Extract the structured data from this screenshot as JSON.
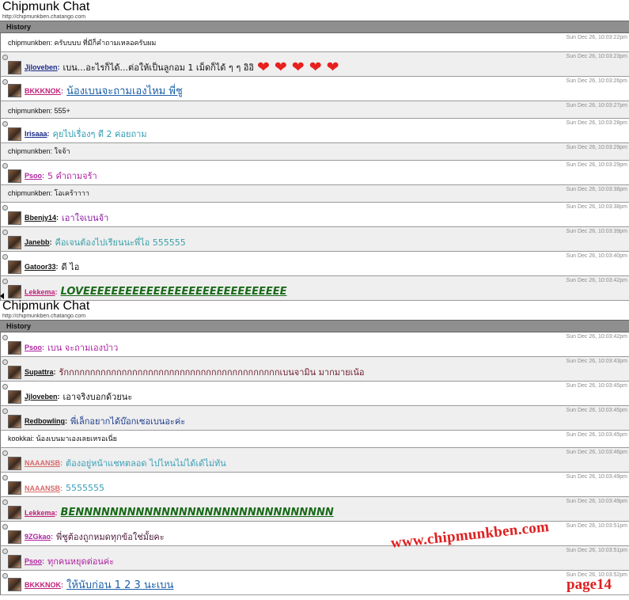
{
  "panels": [
    {
      "title": "Chipmunk Chat",
      "url": "http://chipmunkben.chatango.com",
      "history_label": "History",
      "messages": [
        {
          "type": "sys",
          "text": "chipmunkben: ครับบบบ ที่มีก็คำถามเหลอครับผม",
          "ts": "Sun Dec 26, 10:03:22pm"
        },
        {
          "type": "user",
          "name": "Jjloveben",
          "text": "เบน...อะไรก็ได้...ต่อให้เป็นลูกอม 1 เม็ดก็ได้ ๆ ๆ อิอิ",
          "ts": "Sun Dec 26, 10:03:23pm",
          "name_color": "#1a2a8a",
          "text_color": "#111111",
          "hearts": 5
        },
        {
          "type": "user",
          "name": "BKKKNOK",
          "text": "น้องเบนจะถามเองไหม พี่ชู",
          "ts": "Sun Dec 26, 10:03:26pm",
          "name_color": "#c0207a",
          "text_color": "#1a5fa8",
          "style": "ul"
        },
        {
          "type": "sys",
          "text": "chipmunkben: 555+",
          "ts": "Sun Dec 26, 10:03:27pm"
        },
        {
          "type": "user",
          "name": "lrisaaa",
          "text": "คุยไปเรื่องๆ ดี 2 ค่อยถาม",
          "ts": "Sun Dec 26, 10:03:28pm",
          "name_color": "#1a2a8a",
          "text_color": "#2e9bb2"
        },
        {
          "type": "sys",
          "text": "chipmunkben: ใจจ้า",
          "ts": "Sun Dec 26, 10:03:29pm"
        },
        {
          "type": "user",
          "name": "Psoo",
          "text": "5 คำถามจร้า",
          "ts": "Sun Dec 26, 10:03:29pm",
          "name_color": "#b020a0",
          "text_color": "#b020a0"
        },
        {
          "type": "sys",
          "text": "chipmunkben: โอเคร้าาาา",
          "ts": "Sun Dec 26, 10:03:38pm"
        },
        {
          "type": "user",
          "name": "Bbenjy14",
          "text": "เอาใจเบนจ้า",
          "ts": "Sun Dec 26, 10:03:38pm",
          "name_color": "#111111",
          "text_color": "#8a1aa0"
        },
        {
          "type": "user",
          "name": "Janebb",
          "text": "คือเจนต้องไปเรียนนะพี่ไอ 555555",
          "ts": "Sun Dec 26, 10:03:39pm",
          "name_color": "#111111",
          "text_color": "#3aa0a8"
        },
        {
          "type": "user",
          "name": "Gatoor33",
          "text": "ดี ไอ",
          "ts": "Sun Dec 26, 10:03:40pm",
          "name_color": "#111111",
          "text_color": "#111111"
        },
        {
          "type": "user",
          "name": "Lekkema",
          "text": "LOVEEEEEEEEEEEEEEEEEEEEEEEEEEEEE",
          "ts": "Sun Dec 26, 10:03:42pm",
          "name_color": "#c0207a",
          "text_color": "#1a6a1a",
          "style": "bold ital ul"
        }
      ]
    },
    {
      "title": "Chipmunk Chat",
      "url": "http://chipmunkben.chatango.com",
      "history_label": "History",
      "messages": [
        {
          "type": "user",
          "name": "Psoo",
          "text": "เบน จะถามเองป่าว",
          "ts": "Sun Dec 26, 10:03:42pm",
          "name_color": "#b020a0",
          "text_color": "#b020a0"
        },
        {
          "type": "user",
          "name": "Supattra",
          "text": "รักกกกกกกกกกกกกกกกกกกกกกกกกกกกกกกกกกกกกกกกกเบนจามิน มากมายเน้อ",
          "ts": "Sun Dec 26, 10:03:43pm",
          "name_color": "#111111",
          "text_color": "#6a1a2a"
        },
        {
          "type": "user",
          "name": "Jjloveben",
          "text": "เอาจริงบอกด้วยนะ",
          "ts": "Sun Dec 26, 10:03:45pm",
          "name_color": "#111111",
          "text_color": "#111111"
        },
        {
          "type": "user",
          "name": "Redbowling",
          "text": "พี่เล็กอยากได้บ๊อกเซอเบนอะค่ะ",
          "ts": "Sun Dec 26, 10:03:45pm",
          "name_color": "#111111",
          "text_color": "#1a3a8a"
        },
        {
          "type": "sys",
          "text": "kookkai: น้องเบนมาเองเลยเหรอเนี่ย",
          "ts": "Sun Dec 26, 10:03:45pm"
        },
        {
          "type": "user",
          "name": "NAAANSB",
          "text": "ต้องอยู่หน้าแชทตลอด ไปไหนไม่ได้เด้ไม่ทัน",
          "ts": "Sun Dec 26, 10:03:46pm",
          "name_color": "#d86a6a",
          "text_color": "#3aa0b8"
        },
        {
          "type": "user",
          "name": "NAAANSB",
          "text": "5555555",
          "ts": "Sun Dec 26, 10:03:49pm",
          "name_color": "#d86a6a",
          "text_color": "#3aa0b8"
        },
        {
          "type": "user",
          "name": "Lekkema",
          "text": "BENNNNNNNNNNNNNNNNNNNNNNNNNNNNNN",
          "ts": "Sun Dec 26, 10:03:49pm",
          "name_color": "#c0207a",
          "text_color": "#1a6a1a",
          "style": "bold ital ul"
        },
        {
          "type": "user",
          "name": "9ZGkao",
          "text": "พี่ชูต้องถูกหมดทุกข้อใช่มั้ยคะ",
          "ts": "Sun Dec 26, 10:03:51pm",
          "name_color": "#b020a0",
          "text_color": "#4a1a3a"
        },
        {
          "type": "user",
          "name": "Psoo",
          "text": "ทุกคนหยุดต่อนค่ะ",
          "ts": "Sun Dec 26, 10:03:51pm",
          "name_color": "#b020a0",
          "text_color": "#b020a0"
        },
        {
          "type": "user",
          "name": "BKKKNOK",
          "text": "ให้นับก่อน 1 2 3 นะเบน",
          "ts": "Sun Dec 26, 10:03:52pm",
          "name_color": "#c0207a",
          "text_color": "#1a5fa8",
          "style": "ul"
        }
      ]
    }
  ],
  "watermark": "www.chipmunkben.com",
  "page_label": "page14"
}
